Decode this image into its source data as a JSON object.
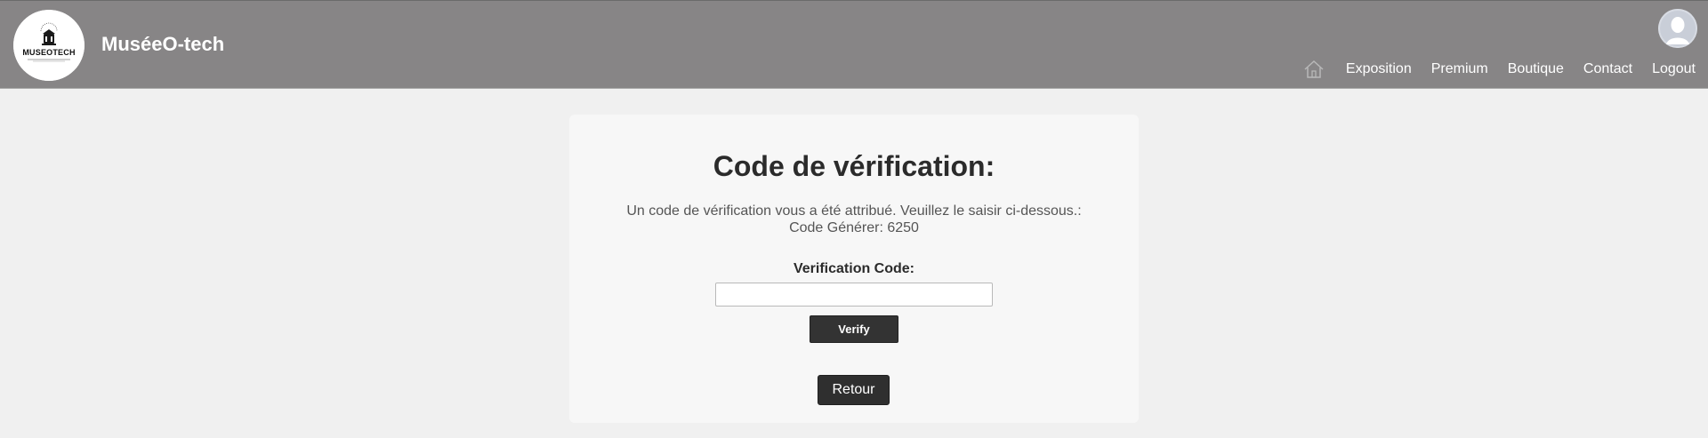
{
  "header": {
    "brand": "MuséeO-tech",
    "logo_text": "MUSEOTECH",
    "nav": {
      "home_icon": "home-icon",
      "items": [
        "Exposition",
        "Premium",
        "Boutique",
        "Contact",
        "Logout"
      ]
    },
    "avatar_icon": "user-avatar-icon"
  },
  "card": {
    "title": "Code de vérification:",
    "description_line1": "Un code de vérification vous a été attribué. Veuillez le saisir ci-dessous.:",
    "description_line2": "Code Générer: 6250",
    "code_label": "Verification Code:",
    "code_value": "",
    "verify_label": "Verify",
    "retour_label": "Retour"
  },
  "colors": {
    "header_bg": "#878586",
    "page_bg": "#f0f0f0",
    "card_bg": "#f7f7f7",
    "button_bg": "#333333"
  }
}
